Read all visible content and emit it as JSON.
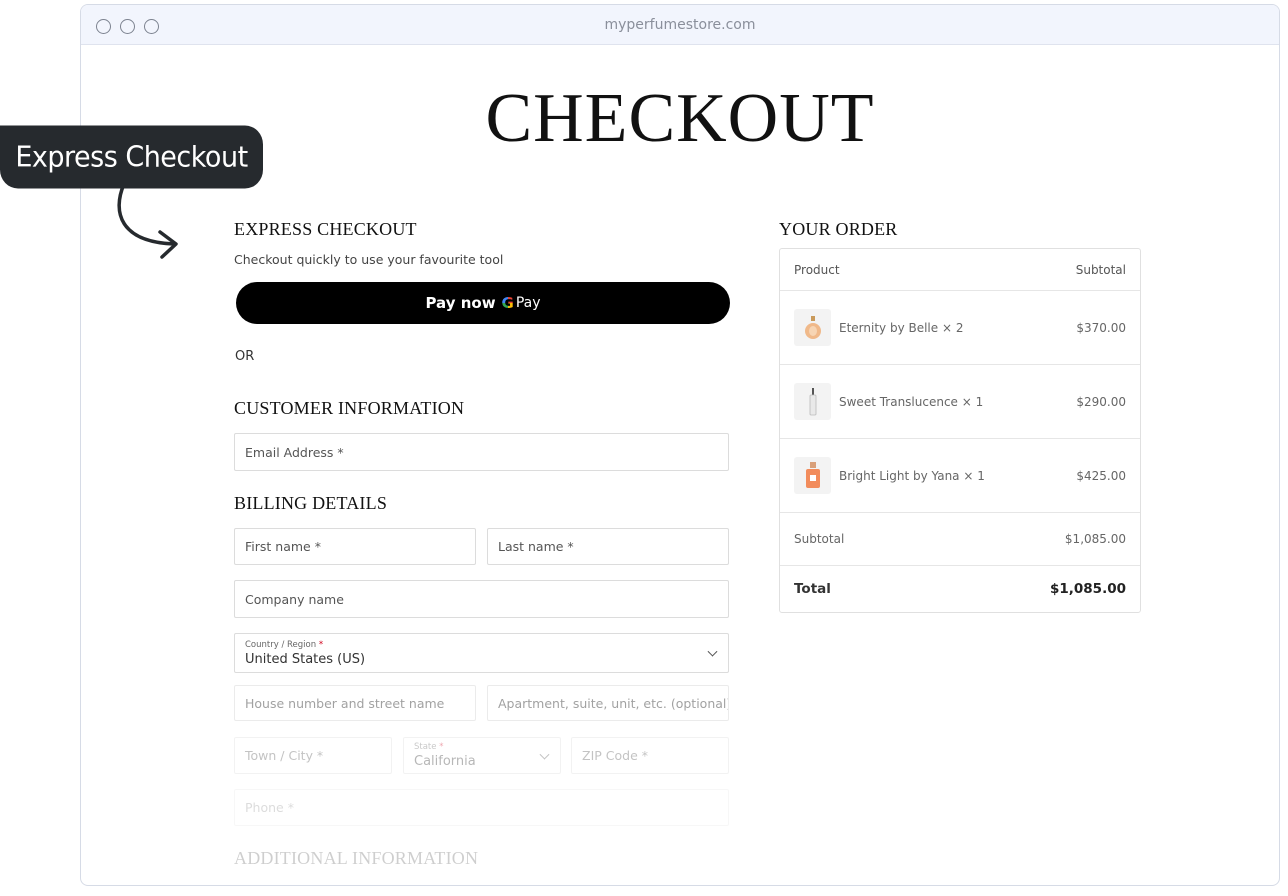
{
  "browser": {
    "url": "myperfumestore.com"
  },
  "page": {
    "title": "CHECKOUT"
  },
  "callout": {
    "label": "Express Checkout"
  },
  "express": {
    "heading": "EXPRESS CHECKOUT",
    "subtitle": "Checkout quickly to use your favourite tool",
    "pay_label": "Pay now",
    "gpay_g": "G",
    "gpay_pay": "Pay",
    "or_label": "OR"
  },
  "customer": {
    "heading": "CUSTOMER INFORMATION",
    "email_placeholder": "Email Address *"
  },
  "billing": {
    "heading": "BILLING DETAILS",
    "first_name": "First name *",
    "last_name": "Last name *",
    "company": "Company name",
    "country_label": "Country / Region",
    "country_value": "United States (US)",
    "street": "House number and street name",
    "apartment": "Apartment, suite, unit, etc. (optional)",
    "city": "Town / City *",
    "state_label": "State",
    "state_value": "California",
    "zip": "ZIP Code *",
    "phone": "Phone *",
    "required_mark": "*"
  },
  "additional": {
    "heading": "ADDITIONAL INFORMATION"
  },
  "order": {
    "heading": "YOUR ORDER",
    "col_product": "Product",
    "col_subtotal": "Subtotal",
    "items": [
      {
        "name": "Eternity by Belle × 2",
        "price": "$370.00"
      },
      {
        "name": "Sweet Translucence × 1",
        "price": "$290.00"
      },
      {
        "name": "Bright Light by Yana × 1",
        "price": "$425.00"
      }
    ],
    "subtotal_label": "Subtotal",
    "subtotal_value": "$1,085.00",
    "total_label": "Total",
    "total_value": "$1,085.00"
  },
  "colors": {
    "accent": "#000000",
    "callout_bg": "#262a2e",
    "titlebar_bg": "#f2f5fd"
  }
}
